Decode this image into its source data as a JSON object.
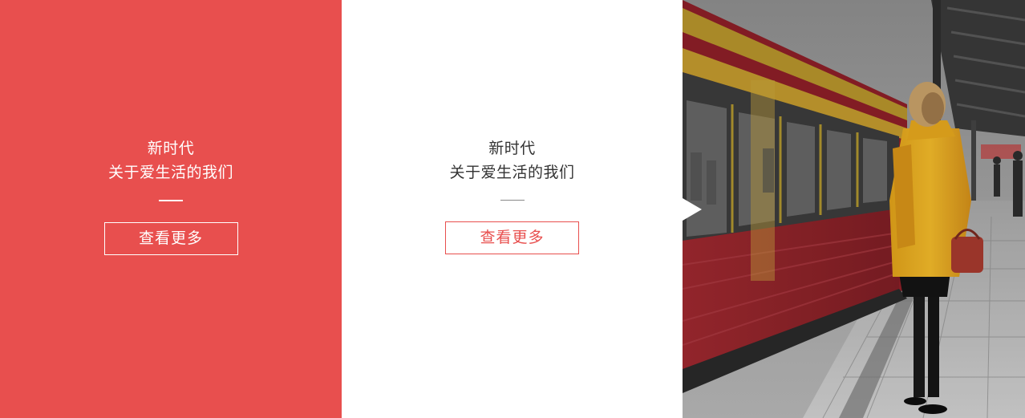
{
  "cards": [
    {
      "line1": "新时代",
      "line2": "关于爱生活的我们",
      "button_label": "查看更多"
    },
    {
      "line1": "新时代",
      "line2": "关于爱生活的我们",
      "button_label": "查看更多"
    }
  ],
  "colors": {
    "accent": "#e84f4e",
    "white": "#ffffff",
    "text_dark": "#333333"
  },
  "photo": {
    "subject": "train-platform-woman-yellow-coat"
  }
}
